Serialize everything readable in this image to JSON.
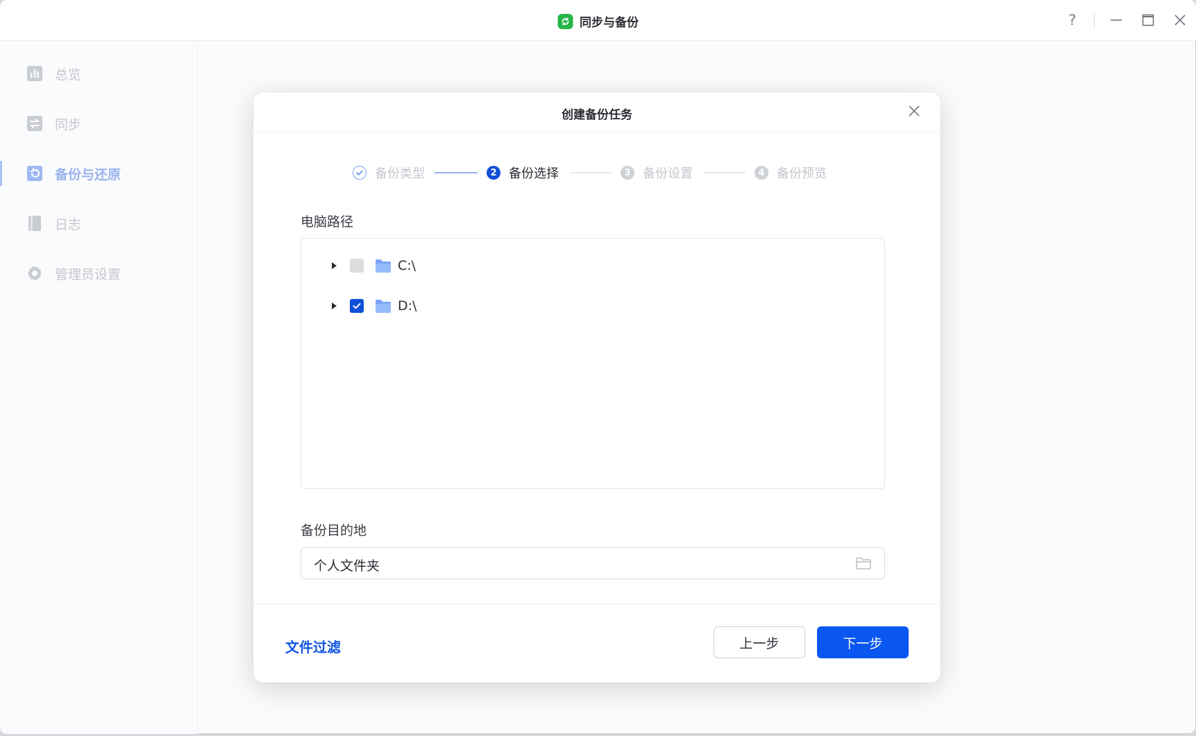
{
  "app": {
    "title": "同步与备份"
  },
  "window_controls": {
    "help": "?",
    "minimize": "minimize-icon",
    "maximize": "maximize-icon",
    "close": "close-icon"
  },
  "sidebar": {
    "items": [
      {
        "label": "总览",
        "icon": "overview-chart-icon",
        "active": false
      },
      {
        "label": "同步",
        "icon": "sync-arrows-icon",
        "active": false
      },
      {
        "label": "备份与还原",
        "icon": "backup-restore-icon",
        "active": true
      },
      {
        "label": "日志",
        "icon": "log-book-icon",
        "active": false
      },
      {
        "label": "管理员设置",
        "icon": "gear-icon",
        "active": false
      }
    ]
  },
  "dialog": {
    "title": "创建备份任务",
    "steps": [
      {
        "number": "1",
        "label": "备份类型",
        "state": "done"
      },
      {
        "number": "2",
        "label": "备份选择",
        "state": "current"
      },
      {
        "number": "3",
        "label": "备份设置",
        "state": "pending"
      },
      {
        "number": "4",
        "label": "备份预览",
        "state": "pending"
      }
    ],
    "source_label": "电脑路径",
    "tree": [
      {
        "label": "C:\\",
        "checked": false,
        "disabled": true
      },
      {
        "label": "D:\\",
        "checked": true,
        "disabled": false
      }
    ],
    "destination_label": "备份目的地",
    "destination_value": "个人文件夹",
    "filter_link": "文件过滤",
    "prev_button": "上一步",
    "next_button": "下一步"
  },
  "colors": {
    "accent": "#0a56f0",
    "app_logo": "#27b64a",
    "disabled_text": "#c4c7cc",
    "folder": "#7aa6f7"
  }
}
